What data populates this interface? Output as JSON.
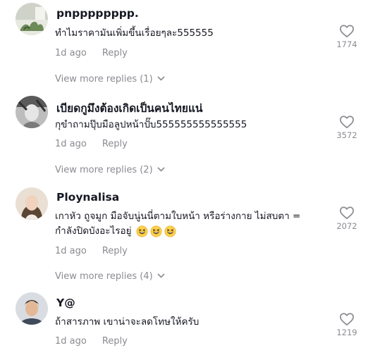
{
  "comments": [
    {
      "username": "pnpppppppp.",
      "text": "ทำไมราคามันเพิ่มขึ้นเรื่อยๆละ555555",
      "time": "1d ago",
      "reply_label": "Reply",
      "likes": "1774",
      "view_more": "View more replies (1)",
      "avatar_icon": "avatar-photo-plant"
    },
    {
      "username": "เบียดกูมึงต้องเกิดเป็นคนไทยแน่",
      "text": "กุขำถามปุ๊บมือลูปหน้าปั๊บ555555555555555",
      "time": "1d ago",
      "reply_label": "Reply",
      "likes": "3572",
      "view_more": "View more replies (2)",
      "avatar_icon": "avatar-photo-bw"
    },
    {
      "username": "Ploynalisa",
      "text_line1": "เกาหัว ถูจมูก มือจับนู่นนี่ตามใบหน้า หรือร่างกาย ไม่สบตา =",
      "text_line2": "กำลังปิดบังอะไรอยู่",
      "emojis": [
        "grinning-squinting-face-emoji",
        "grinning-squinting-face-emoji",
        "grinning-squinting-face-emoji"
      ],
      "time": "1d ago",
      "reply_label": "Reply",
      "likes": "2072",
      "view_more": "View more replies (4)",
      "avatar_icon": "avatar-photo-woman"
    },
    {
      "username": "Y@",
      "text": "ถ้าสารภาพ เขาน่าจะลดโทษให้ครับ",
      "time": "1d ago",
      "reply_label": "Reply",
      "likes": "1219",
      "avatar_icon": "avatar-photo-man"
    }
  ],
  "colors": {
    "primary_text": "#161823",
    "secondary_text": "#8a8b91"
  },
  "icons": {
    "like": "heart-outline-icon",
    "expand": "chevron-down-icon"
  }
}
